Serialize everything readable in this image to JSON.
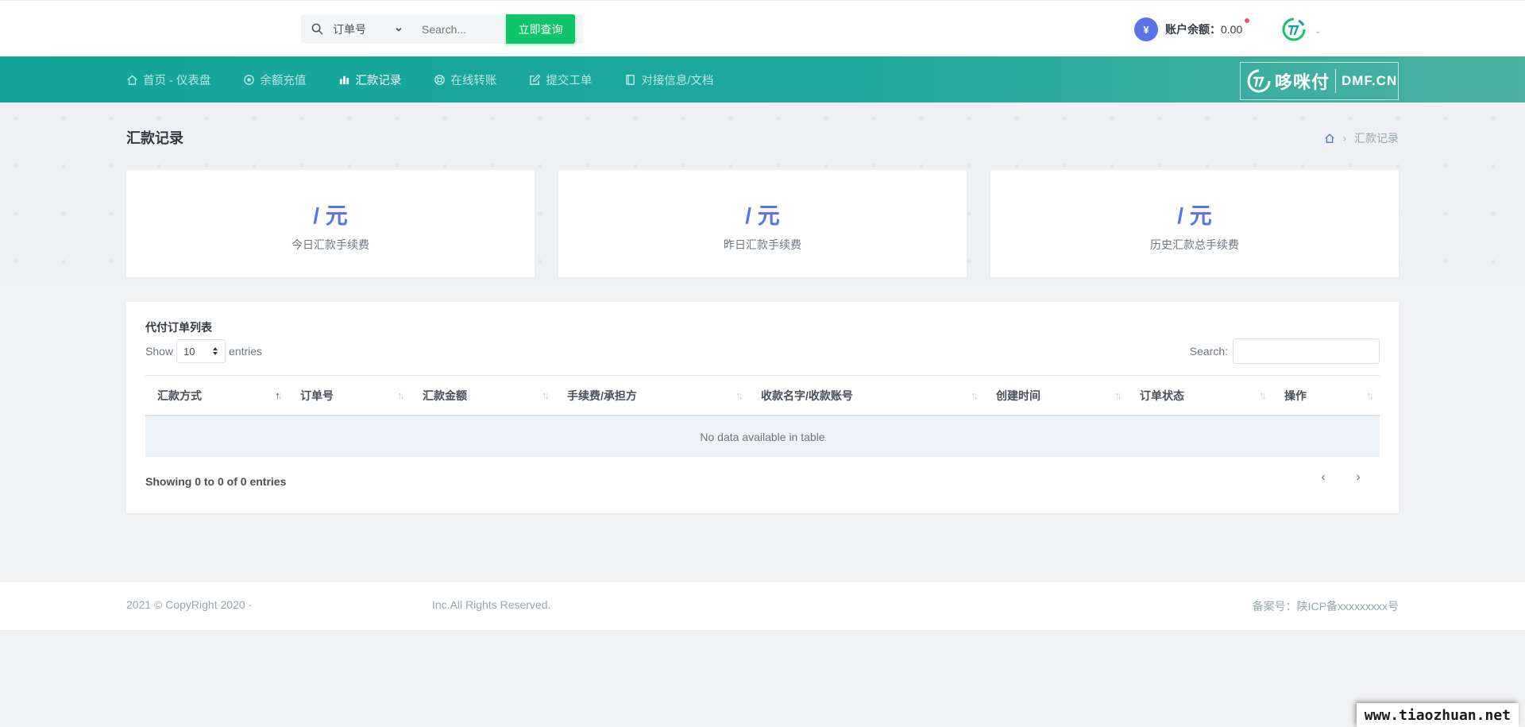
{
  "topbar": {
    "search": {
      "field_select": "订单号",
      "placeholder": "Search...",
      "button_label": "立即查询"
    },
    "balance": {
      "currency_symbol": "¥",
      "label": "账户余额：",
      "value": "0.00"
    }
  },
  "nav": {
    "items": [
      {
        "label": "首页 - 仪表盘",
        "icon": "home-icon"
      },
      {
        "label": "余额充值",
        "icon": "record-icon"
      },
      {
        "label": "汇款记录",
        "icon": "bar-chart-icon"
      },
      {
        "label": "在线转账",
        "icon": "support-icon"
      },
      {
        "label": "提交工单",
        "icon": "edit-icon"
      },
      {
        "label": "对接信息/文档",
        "icon": "book-icon"
      }
    ],
    "active_index": 2,
    "logo": {
      "cn": "哆咪付",
      "en": "DMF.CN"
    }
  },
  "page": {
    "title": "汇款记录",
    "breadcrumb": [
      "home-icon",
      "汇款记录"
    ]
  },
  "stats": [
    {
      "value": "/ 元",
      "label": "今日汇款手续费"
    },
    {
      "value": "/ 元",
      "label": "昨日汇款手续费"
    },
    {
      "value": "/ 元",
      "label": "历史汇款总手续费"
    }
  ],
  "table": {
    "title": "代付订单列表",
    "show_label": "Show",
    "length_value": "10",
    "entries_label": "entries",
    "search_label": "Search:",
    "columns": [
      "汇款方式",
      "订单号",
      "汇款金额",
      "手续费/承担方",
      "收款名字/收款账号",
      "创建时间",
      "订单状态",
      "操作"
    ],
    "empty_text": "No data available in table",
    "info_text": "Showing 0 to 0 of 0 entries",
    "pager": {
      "prev": "‹",
      "next": "›"
    }
  },
  "footer": {
    "left": "2021 © CopyRight 2020 ·",
    "middle": "Inc.All Rights Reserved.",
    "right": "备案号：陕ICP备xxxxxxxxx号"
  },
  "watermark": "www.tiaozhuan.net",
  "colors": {
    "nav_start": "#12a49a",
    "nav_end": "#4db2a0",
    "primary": "#5b73e8",
    "success": "#10c469"
  }
}
